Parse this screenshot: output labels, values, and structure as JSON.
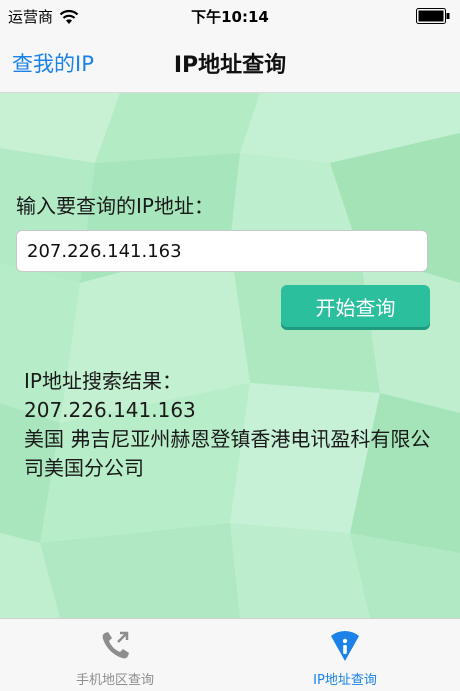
{
  "status_bar": {
    "carrier": "运营商",
    "time": "下午10:14"
  },
  "nav": {
    "left_label": "查我的IP",
    "title": "IP地址查询"
  },
  "form": {
    "prompt": "输入要查询的IP地址：",
    "ip_value": "207.226.141.163",
    "button_label": "开始查询"
  },
  "result": {
    "heading": "IP地址搜索结果：",
    "ip": "207.226.141.163",
    "location": "美国 弗吉尼亚州赫恩登镇香港电讯盈科有限公司美国分公司"
  },
  "tabs": [
    {
      "label": "手机地区查询",
      "icon": "phone-icon",
      "active": false
    },
    {
      "label": "IP地址查询",
      "icon": "wifi-info-icon",
      "active": true
    }
  ],
  "colors": {
    "accent": "#1a82e8",
    "button": "#2bbf9d",
    "inactive_tab": "#8e8e8e"
  }
}
